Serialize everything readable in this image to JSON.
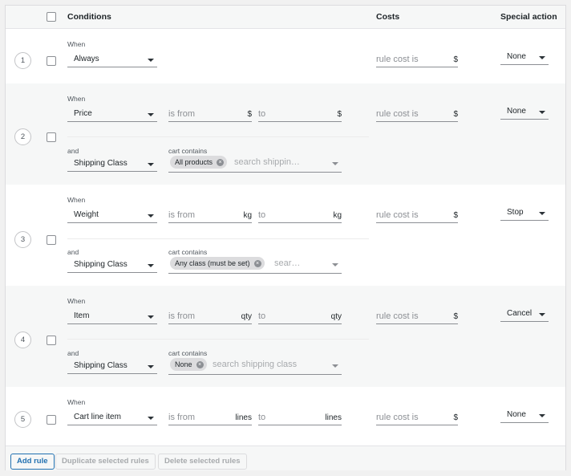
{
  "header": {
    "conditions": "Conditions",
    "costs": "Costs",
    "special_action": "Special action"
  },
  "labels": {
    "when": "When",
    "and": "and",
    "cart_contains": "cart contains",
    "is_from": "is from",
    "to": "to",
    "rule_cost_is": "rule cost is"
  },
  "rows": [
    {
      "num": "1",
      "condition": "Always",
      "cost_unit": "$",
      "special_action": "None"
    },
    {
      "num": "2",
      "condition": "Price",
      "from_unit": "$",
      "to_unit": "$",
      "cost_unit": "$",
      "special_action": "None",
      "and_condition": "Shipping Class",
      "chip": "All products",
      "search_placeholder": "search shippin…"
    },
    {
      "num": "3",
      "condition": "Weight",
      "from_unit": "kg",
      "to_unit": "kg",
      "cost_unit": "$",
      "special_action": "Stop",
      "and_condition": "Shipping Class",
      "chip": "Any class (must be set)",
      "search_placeholder": "sear…"
    },
    {
      "num": "4",
      "condition": "Item",
      "from_unit": "qty",
      "to_unit": "qty",
      "cost_unit": "$",
      "special_action": "Cancel",
      "and_condition": "Shipping Class",
      "chip": "None",
      "search_placeholder": "search shipping class"
    },
    {
      "num": "5",
      "condition": "Cart line item",
      "from_unit": "lines",
      "to_unit": "lines",
      "cost_unit": "$",
      "special_action": "None"
    }
  ],
  "footer": {
    "add_rule": "Add rule",
    "duplicate": "Duplicate selected rules",
    "delete": "Delete selected rules"
  }
}
